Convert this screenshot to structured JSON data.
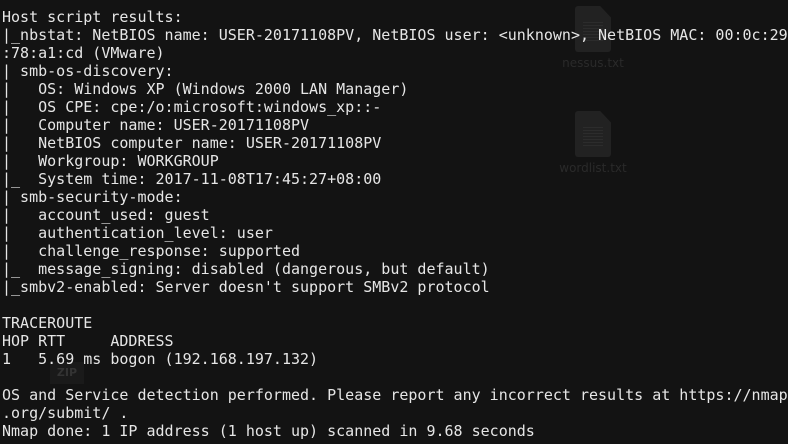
{
  "desktop": {
    "icons": [
      {
        "label": "nessus.txt",
        "icon": "text-file-icon"
      },
      {
        "label": "wordlist.txt",
        "icon": "text-file-icon"
      },
      {
        "label": "ZIP",
        "icon": "zip-archive-icon"
      }
    ]
  },
  "terminal": {
    "lines": [
      "Host script results:",
      "|_nbstat: NetBIOS name: USER-20171108PV, NetBIOS user: <unknown>, NetBIOS MAC: 00:0c:29",
      ":78:a1:cd (VMware)",
      "| smb-os-discovery:",
      "|   OS: Windows XP (Windows 2000 LAN Manager)",
      "|   OS CPE: cpe:/o:microsoft:windows_xp::-",
      "|   Computer name: USER-20171108PV",
      "|   NetBIOS computer name: USER-20171108PV",
      "|   Workgroup: WORKGROUP",
      "|_  System time: 2017-11-08T17:45:27+08:00",
      "| smb-security-mode:",
      "|   account_used: guest",
      "|   authentication_level: user",
      "|   challenge_response: supported",
      "|_  message_signing: disabled (dangerous, but default)",
      "|_smbv2-enabled: Server doesn't support SMBv2 protocol",
      "",
      "TRACEROUTE",
      "HOP RTT     ADDRESS",
      "1   5.69 ms bogon (192.168.197.132)",
      "",
      "OS and Service detection performed. Please report any incorrect results at https://nmap",
      ".org/submit/ .",
      "Nmap done: 1 IP address (1 host up) scanned in 9.68 seconds"
    ]
  }
}
